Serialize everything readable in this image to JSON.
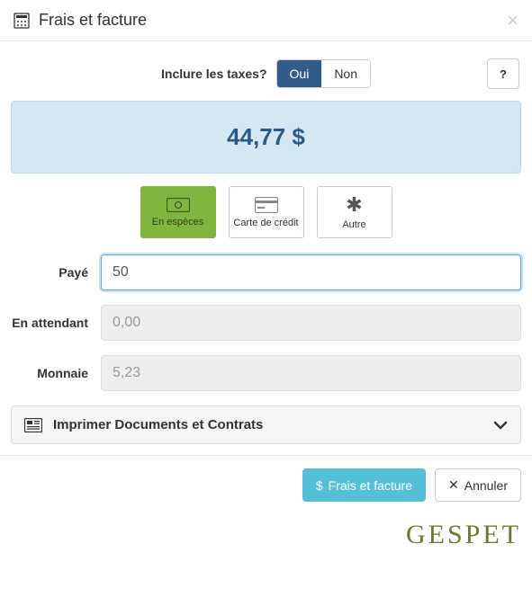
{
  "modal": {
    "title": "Frais et facture"
  },
  "tax": {
    "label": "Inclure les taxes?",
    "yes": "Oui",
    "no": "Non",
    "help": "?"
  },
  "amount": "44,77 $",
  "payMethods": {
    "cash": "En espèces",
    "card": "Carte de crédit",
    "other": "Autre"
  },
  "fields": {
    "paid_label": "Payé",
    "paid_value": "50",
    "pending_label": "En attendant",
    "pending_value": "0,00",
    "change_label": "Monnaie",
    "change_value": "5,23"
  },
  "accordion": {
    "title": "Imprimer Documents et Contrats"
  },
  "footer": {
    "primary": "Frais et facture",
    "cancel": "Annuler"
  },
  "brand": "GESPET"
}
